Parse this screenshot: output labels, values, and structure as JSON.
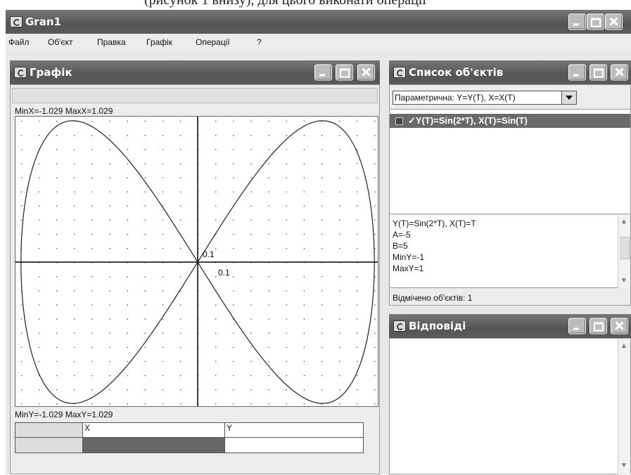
{
  "caption": "(рисунок 1 внизу), для цього виконати операції",
  "app": {
    "title": "Gran1"
  },
  "menu": [
    "Файл",
    "Об'єкт",
    "Правка",
    "Графік",
    "Операції",
    "?"
  ],
  "graph_window": {
    "title": "Графік",
    "top_status": "MinX=-1.029  MaxX=1.029",
    "bottom_status": "MinY=-1.029  MaxY=1.029",
    "axis_label_y": "0.1",
    "axis_label_x": "0.1",
    "table_headers": [
      "X",
      "Y"
    ]
  },
  "objects_window": {
    "title": "Список об'єктів",
    "type_select": "Параметрична: Y=Y(T), X=X(T)",
    "selected_object": "✓Y(T)=Sin(2*T), X(T)=Sin(T)",
    "info_lines": [
      "Y(T)=Sin(2*T), X(T)=T",
      "A=-5",
      "B=5",
      "MinY=-1",
      "MaxY=1"
    ],
    "status": "Відмічено об'єктів: 1"
  },
  "answers_window": {
    "title": "Відповіді"
  },
  "chart_data": {
    "type": "line",
    "series": [
      {
        "name": "Y(T)=Sin(2*T), X(T)=Sin(T)",
        "x": "sin(T)",
        "y": "sin(2*T)",
        "t_range": [
          -5,
          5
        ]
      }
    ],
    "xlim": [
      -1.029,
      1.029
    ],
    "ylim": [
      -1.029,
      1.029
    ],
    "grid": true
  },
  "colors": {
    "titlebar": "#666666",
    "curve": "#222222",
    "selection": "#6a6a6a"
  }
}
